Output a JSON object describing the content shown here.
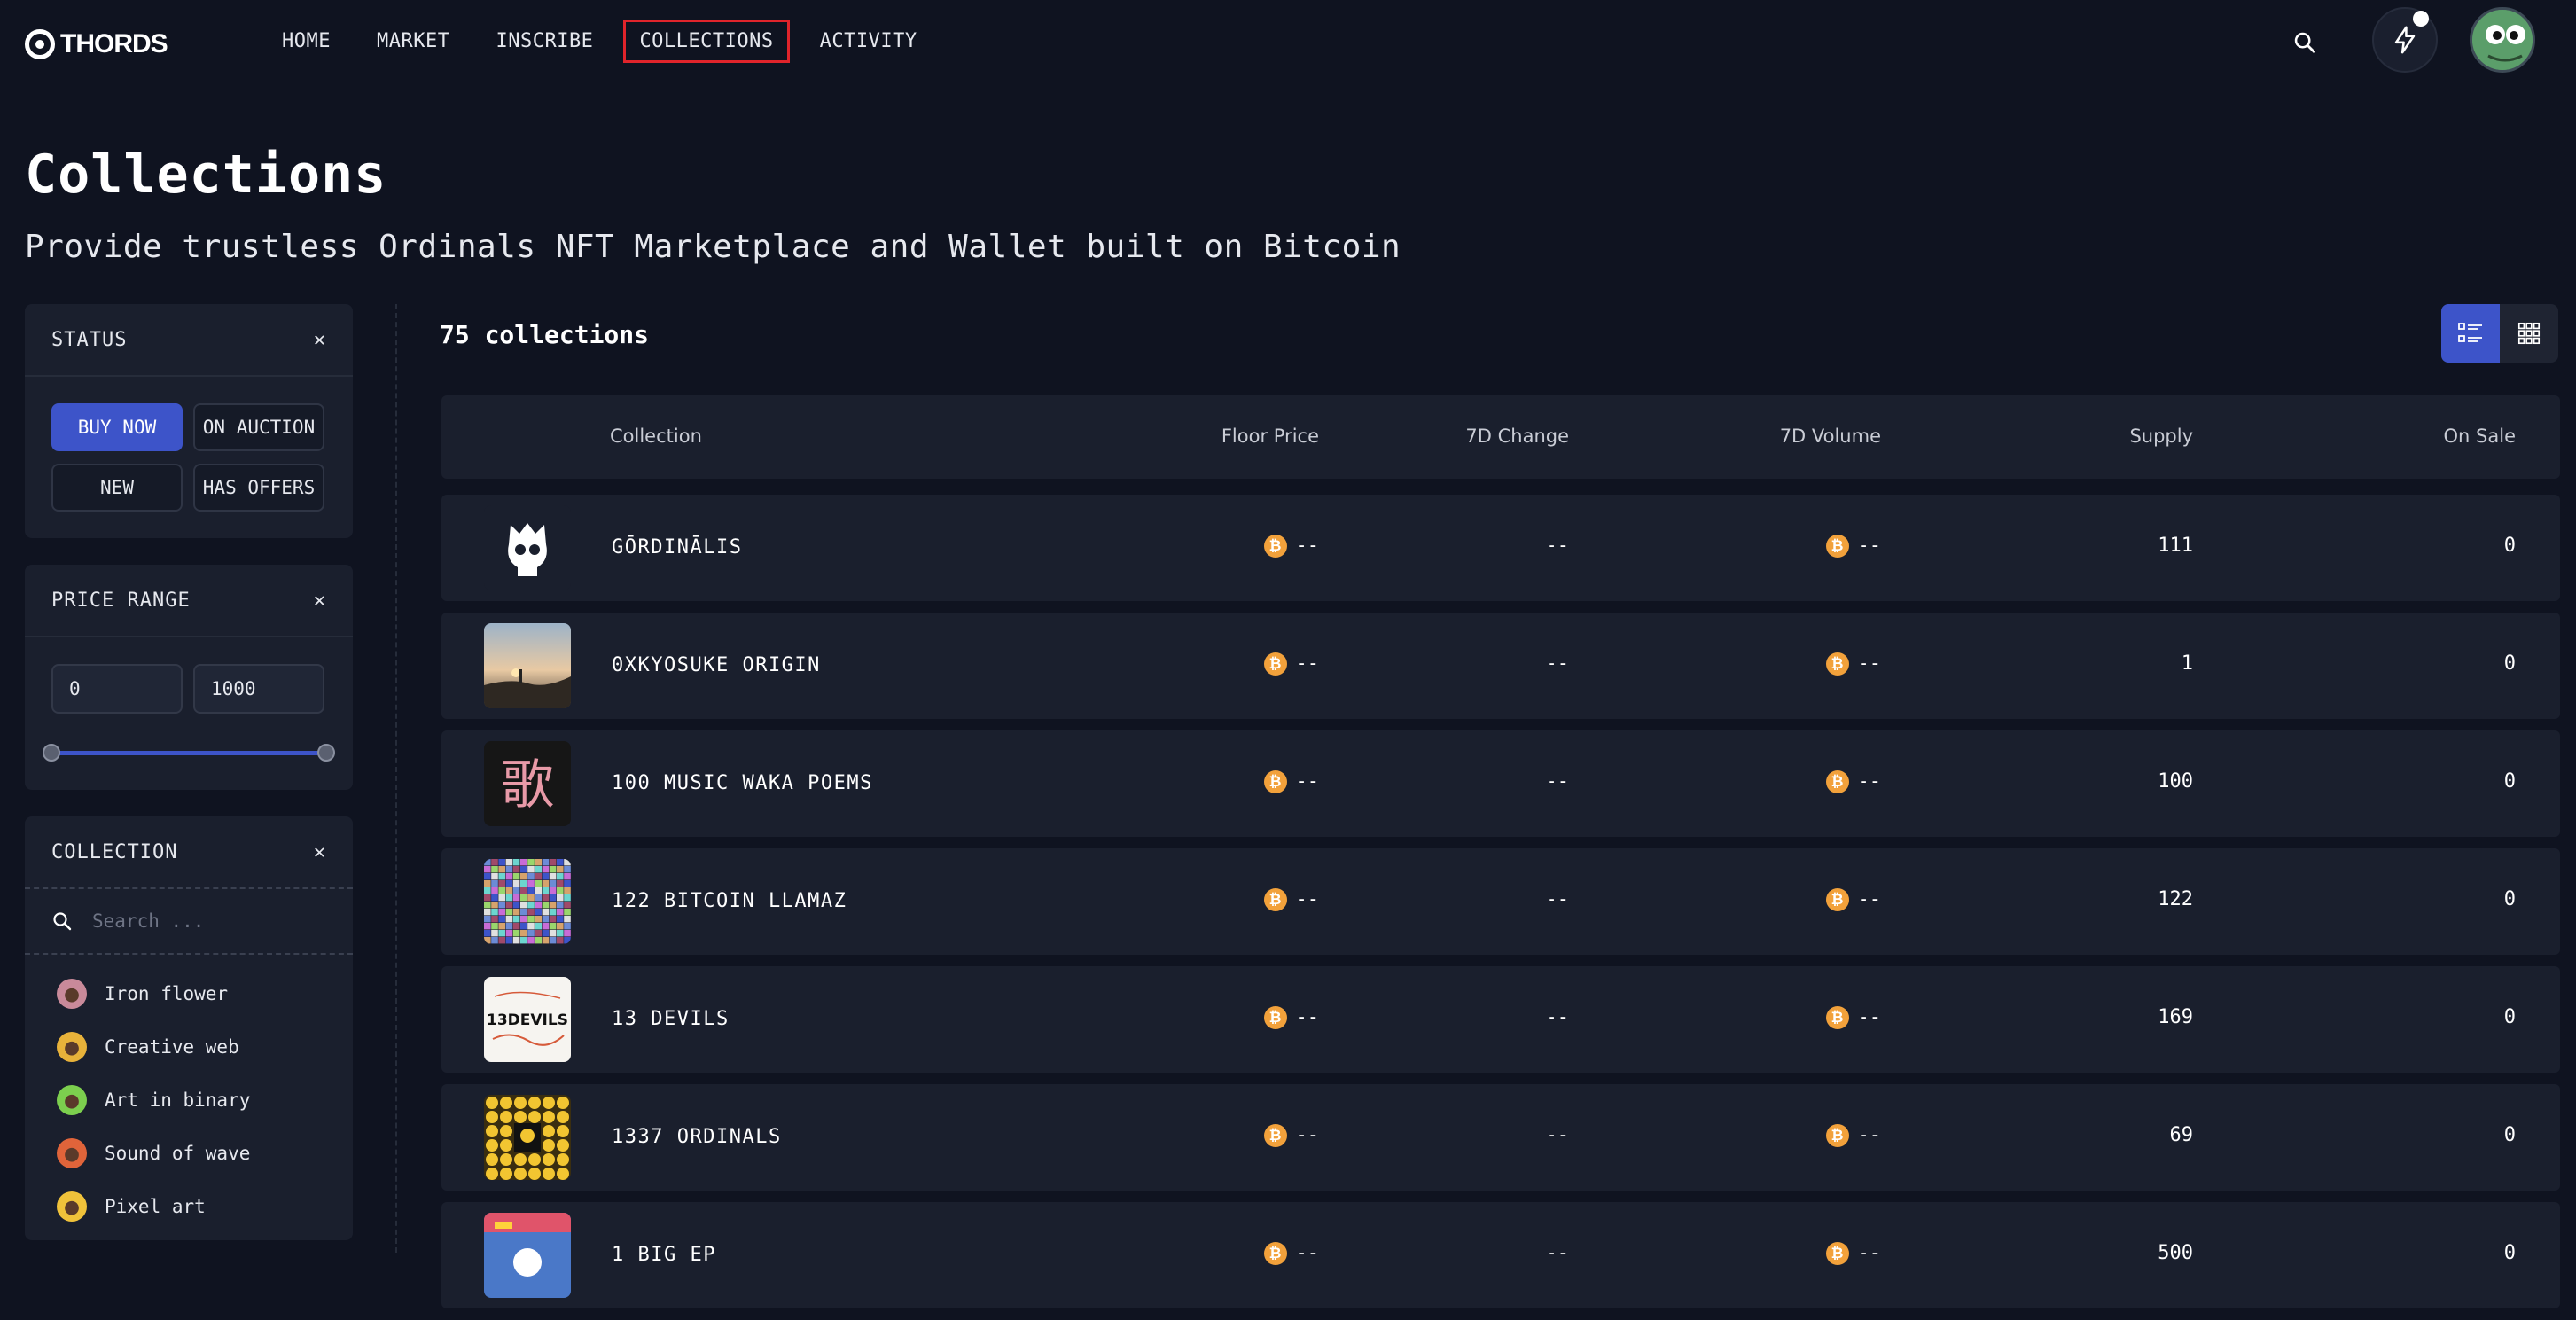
{
  "brand": {
    "name": "THORDS"
  },
  "nav": {
    "items": [
      "HOME",
      "MARKET",
      "INSCRIBE",
      "COLLECTIONS",
      "ACTIVITY"
    ],
    "active": "COLLECTIONS"
  },
  "header": {
    "search_icon": "search-icon",
    "activity_icon": "lightning-icon",
    "avatar": "frog-avatar"
  },
  "hero": {
    "title": "Collections",
    "subtitle": "Provide trustless Ordinals NFT Marketplace and Wallet built on Bitcoin"
  },
  "filters": {
    "status": {
      "title": "STATUS",
      "chips": [
        {
          "label": "BUY NOW",
          "selected": true
        },
        {
          "label": "ON AUCTION",
          "selected": false
        },
        {
          "label": "NEW",
          "selected": false
        },
        {
          "label": "HAS OFFERS",
          "selected": false
        }
      ]
    },
    "price_range": {
      "title": "PRICE RANGE",
      "min": "0",
      "max": "1000"
    },
    "collection": {
      "title": "COLLECTION",
      "search_placeholder": "Search ...",
      "items": [
        {
          "label": "Iron flower",
          "color": "#c98a9a"
        },
        {
          "label": "Creative web",
          "color": "#e8b23a"
        },
        {
          "label": "Art in binary",
          "color": "#7ccf4e"
        },
        {
          "label": "Sound of wave",
          "color": "#e0643a"
        },
        {
          "label": "Pixel art",
          "color": "#f0c23a"
        }
      ]
    }
  },
  "main": {
    "count_label": "75 collections",
    "view": {
      "list_icon": "list-view-icon",
      "grid_icon": "grid-view-icon",
      "active": "list"
    },
    "columns": [
      "Collection",
      "Floor Price",
      "7D Change",
      "7D Volume",
      "Supply",
      "On Sale"
    ],
    "rows": [
      {
        "name": "GŌRDINĀLIS",
        "floor": "--",
        "change": "--",
        "volume": "--",
        "supply": "111",
        "on_sale": "0",
        "thumb": "skull"
      },
      {
        "name": "0XKYOSUKE ORIGIN",
        "floor": "--",
        "change": "--",
        "volume": "--",
        "supply": "1",
        "on_sale": "0",
        "thumb": "sunset"
      },
      {
        "name": "100 MUSIC WAKA POEMS",
        "floor": "--",
        "change": "--",
        "volume": "--",
        "supply": "100",
        "on_sale": "0",
        "thumb": "kanji"
      },
      {
        "name": "122 BITCOIN LLAMAZ",
        "floor": "--",
        "change": "--",
        "volume": "--",
        "supply": "122",
        "on_sale": "0",
        "thumb": "mosaic"
      },
      {
        "name": "13 DEVILS",
        "floor": "--",
        "change": "--",
        "volume": "--",
        "supply": "169",
        "on_sale": "0",
        "thumb": "devils"
      },
      {
        "name": "1337 ORDINALS",
        "floor": "--",
        "change": "--",
        "volume": "--",
        "supply": "69",
        "on_sale": "0",
        "thumb": "smileys"
      },
      {
        "name": "1 BIG EP",
        "floor": "--",
        "change": "--",
        "volume": "--",
        "supply": "500",
        "on_sale": "0",
        "thumb": "ep"
      }
    ],
    "kanji": "歌",
    "devils_thumb_text": "13DEVILS",
    "currency_symbol": "₿"
  }
}
